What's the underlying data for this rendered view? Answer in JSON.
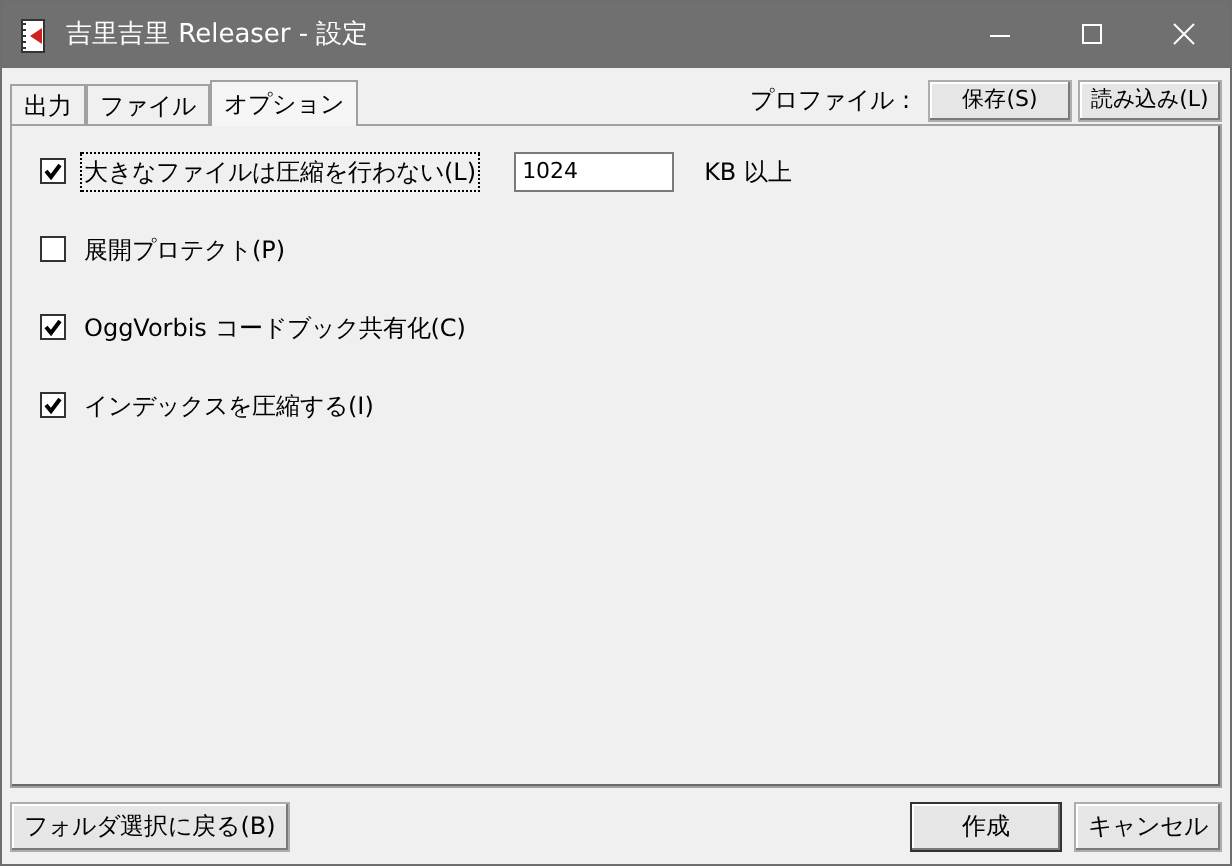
{
  "window": {
    "title": "吉里吉里 Releaser - 設定"
  },
  "tabs": [
    {
      "label": "出力",
      "selected": false
    },
    {
      "label": "ファイル",
      "selected": false
    },
    {
      "label": "オプション",
      "selected": true
    }
  ],
  "profile": {
    "label": "プロファイル :",
    "buttons": [
      "保存(S)",
      "読み込み(L)"
    ]
  },
  "options": [
    {
      "label": "大きなファイルは圧縮を行わない(L)",
      "checked": true,
      "focused": true,
      "field": {
        "value": "1024",
        "unit": "KB 以上"
      }
    },
    {
      "label": "展開プロテクト(P)",
      "checked": false,
      "focused": false
    },
    {
      "label": "OggVorbis コードブック共有化(C)",
      "checked": true,
      "focused": false
    },
    {
      "label": "インデックスを圧縮する(I)",
      "checked": true,
      "focused": false
    }
  ],
  "footer": {
    "back": "フォルダ選択に戻る(B)",
    "buttons": [
      {
        "label": "作成",
        "default": true
      },
      {
        "label": "キャンセル",
        "default": false
      }
    ]
  }
}
